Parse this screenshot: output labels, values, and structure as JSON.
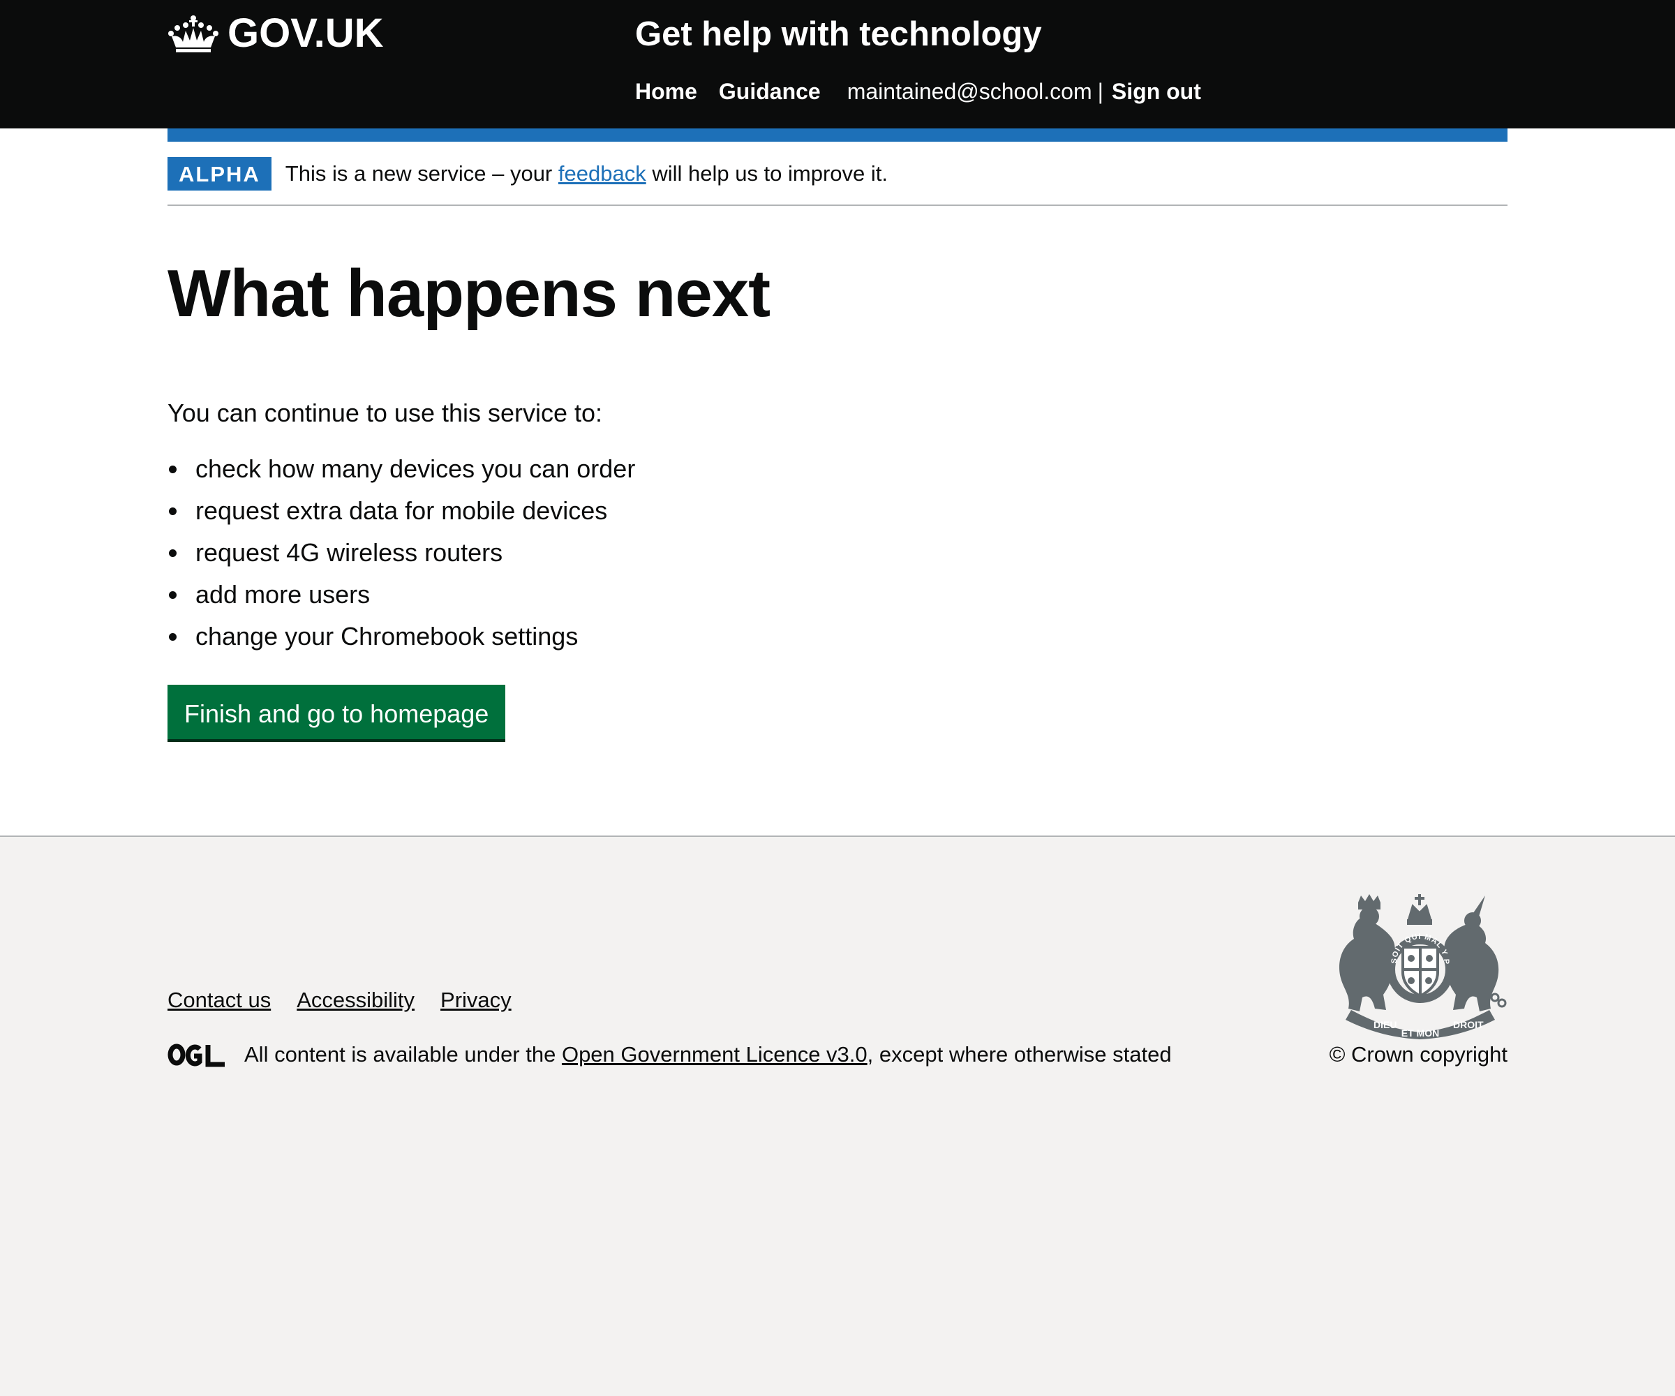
{
  "header": {
    "logo_text": "GOV.UK",
    "service_name": "Get help with technology",
    "nav": {
      "home": "Home",
      "guidance": "Guidance",
      "user_email": "maintained@school.com",
      "separator": "|",
      "sign_out": "Sign out"
    }
  },
  "phase_banner": {
    "tag": "ALPHA",
    "text_before": "This is a new service – your ",
    "link": "feedback",
    "text_after": " will help us to improve it."
  },
  "main": {
    "heading": "What happens next",
    "lead": "You can continue to use this service to:",
    "bullets": [
      "check how many devices you can order",
      "request extra data for mobile devices",
      "request 4G wireless routers",
      "add more users",
      "change your Chromebook settings"
    ],
    "button": "Finish and go to homepage"
  },
  "footer": {
    "links": [
      "Contact us",
      "Accessibility",
      "Privacy"
    ],
    "licence_before": "All content is available under the ",
    "licence_link": "Open Government Licence v3.0",
    "licence_after": ", except where otherwise stated",
    "copyright": "© Crown copyright",
    "crest_motto_top": "HONI SOIT QUI MAL Y PENSE",
    "crest_motto_left": "DIEU",
    "crest_motto_mid": "ET MON",
    "crest_motto_right": "DROIT"
  },
  "colors": {
    "header_bg": "#0b0c0c",
    "brand_blue": "#1d70b8",
    "button_green": "#00703c",
    "footer_bg": "#f3f2f1",
    "crest_grey": "#626a6e"
  }
}
